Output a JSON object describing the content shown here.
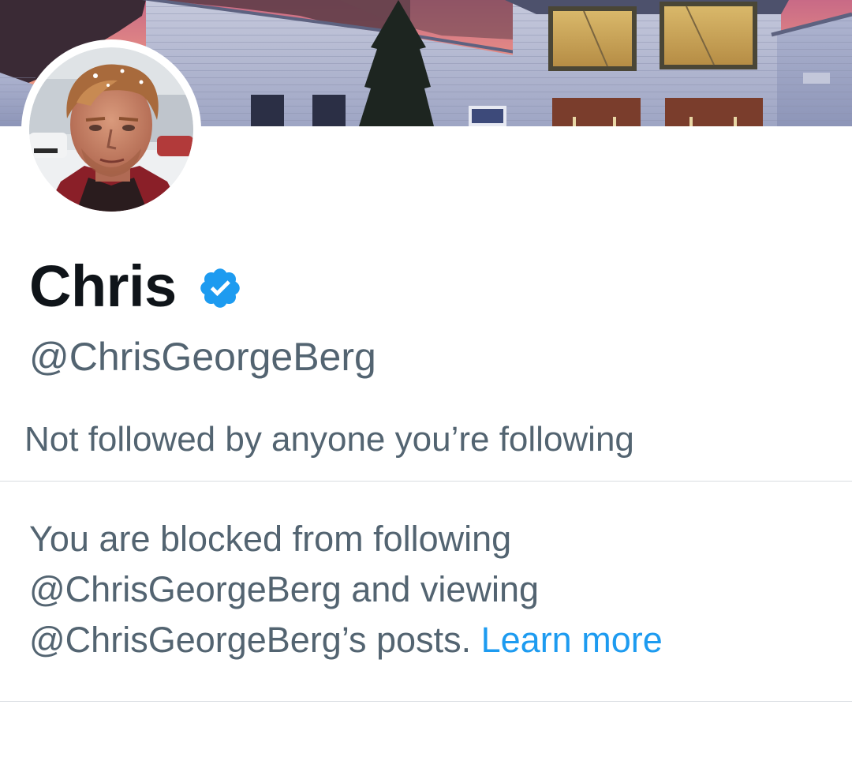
{
  "profile": {
    "display_name": "Chris",
    "handle": "@ChrisGeorgeBerg",
    "verified": true,
    "social_context": "Not followed by anyone you’re following"
  },
  "blocked_notice": {
    "line1": "You are blocked from following",
    "line2": "@ChrisGeorgeBerg and viewing",
    "line3": "@ChrisGeorgeBerg’s posts.",
    "learn_more": "Learn more"
  },
  "icons": {
    "verified": "verified-badge-icon"
  },
  "colors": {
    "primary_text": "#0f1419",
    "secondary_text": "#536471",
    "link": "#1d9bf0",
    "verified_blue": "#1d9bf0",
    "divider": "#d9dde1"
  }
}
